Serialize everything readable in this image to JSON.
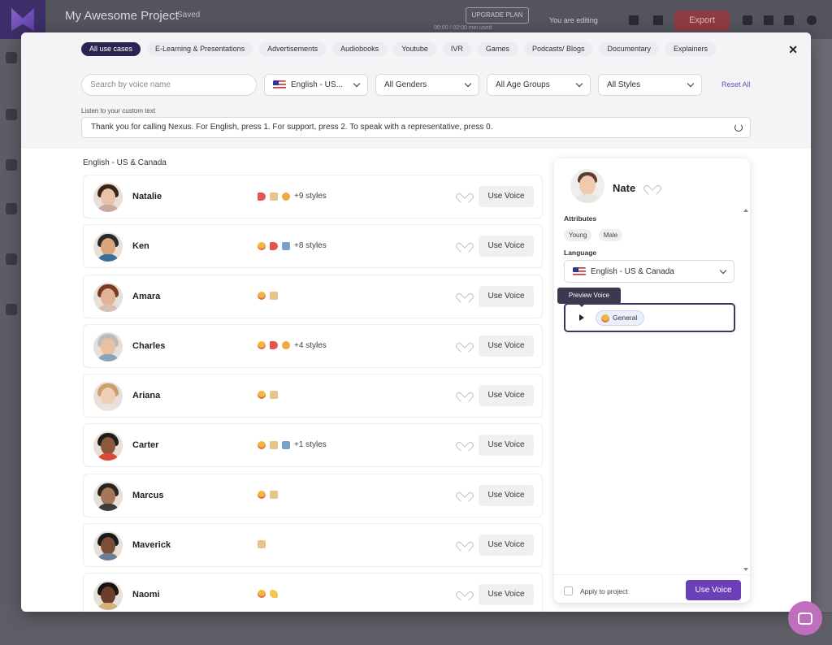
{
  "background": {
    "project_title": "My Awesome Project",
    "saved_label": "Saved",
    "upgrade_label": "UPGRADE PLAN",
    "usage_text": "00:00 / 02:00 min used",
    "editing_label": "You are editing",
    "export_label": "Export"
  },
  "tabs": [
    {
      "label": "All use cases",
      "active": true
    },
    {
      "label": "E-Learning & Presentations"
    },
    {
      "label": "Advertisements"
    },
    {
      "label": "Audiobooks"
    },
    {
      "label": "Youtube"
    },
    {
      "label": "IVR"
    },
    {
      "label": "Games"
    },
    {
      "label": "Podcasts/ Blogs"
    },
    {
      "label": "Documentary"
    },
    {
      "label": "Explainers"
    }
  ],
  "filters": {
    "search_placeholder": "Search by voice name",
    "language": "English - US...",
    "gender": "All Genders",
    "age": "All Age Groups",
    "style": "All Styles",
    "reset_label": "Reset All"
  },
  "custom_text": {
    "label": "Listen to your custom text",
    "value": "Thank you for calling Nexus. For English, press 1. For support, press 2. To speak with a representative, press 0."
  },
  "section_title": "English - US & Canada",
  "use_voice_label": "Use Voice",
  "voices": [
    {
      "name": "Natalie",
      "icons": [
        "mega",
        "scroll",
        "meh"
      ],
      "extra": "+9 styles",
      "skin": "#e9c3a8",
      "hair": "#3a2519",
      "body": "#c9a9a0"
    },
    {
      "name": "Ken",
      "icons": [
        "smile",
        "mega",
        "robot"
      ],
      "extra": "+8 styles",
      "skin": "#d9a57f",
      "hair": "#2a2a2a",
      "body": "#3a6f9c"
    },
    {
      "name": "Amara",
      "icons": [
        "smile",
        "scroll"
      ],
      "extra": "",
      "skin": "#e4b396",
      "hair": "#7a3c20",
      "body": "#d7bfb2"
    },
    {
      "name": "Charles",
      "icons": [
        "smile",
        "mega",
        "meh"
      ],
      "extra": "+4 styles",
      "skin": "#e8c0a4",
      "hair": "#bcbcbc",
      "body": "#8aa3b8"
    },
    {
      "name": "Ariana",
      "icons": [
        "smile",
        "scroll"
      ],
      "extra": "",
      "skin": "#f0cfb7",
      "hair": "#c9a06c",
      "body": "#ece3dc"
    },
    {
      "name": "Carter",
      "icons": [
        "smile",
        "scroll",
        "robot"
      ],
      "extra": "+1 styles",
      "skin": "#8a5a3b",
      "hair": "#1d1d1d",
      "body": "#d84a3a"
    },
    {
      "name": "Marcus",
      "icons": [
        "smile",
        "scroll"
      ],
      "extra": "",
      "skin": "#a5775a",
      "hair": "#2a2520",
      "body": "#3d3d3d"
    },
    {
      "name": "Maverick",
      "icons": [
        "scroll"
      ],
      "extra": "",
      "skin": "#7a4f36",
      "hair": "#1a1a1a",
      "body": "#6c7e96"
    },
    {
      "name": "Naomi",
      "icons": [
        "smile",
        "arm"
      ],
      "extra": "",
      "skin": "#6a3f2c",
      "hair": "#1a1210",
      "body": "#d4b07c"
    }
  ],
  "detail": {
    "name": "Nate",
    "attributes_label": "Attributes",
    "attributes": [
      "Young",
      "Male"
    ],
    "language_label": "Language",
    "language_value": "English - US & Canada",
    "tooltip": "Preview Voice",
    "style_chip": "General",
    "apply_label": "Apply to project",
    "use_voice_label": "Use Voice"
  },
  "colors": {
    "accent": "#6a3fb8",
    "active_tab": "#2a2550",
    "reset_link": "#6a4fc4"
  }
}
